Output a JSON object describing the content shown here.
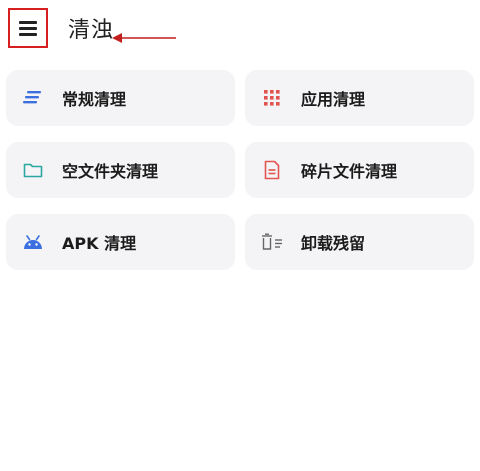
{
  "header": {
    "title": "清浊"
  },
  "colors": {
    "highlight_box": "#d61f1f",
    "arrow": "#c41f1f",
    "card_bg": "#f4f4f6",
    "blue": "#3b6fe0",
    "red": "#e2544f",
    "teal": "#2aa7a0",
    "gray": "#666666"
  },
  "cards": [
    {
      "label": "常规清理",
      "icon": "lines-icon"
    },
    {
      "label": "应用清理",
      "icon": "grid-dots-icon"
    },
    {
      "label": "空文件夹清理",
      "icon": "folder-icon"
    },
    {
      "label": "碎片文件清理",
      "icon": "document-icon"
    },
    {
      "label": "APK 清理",
      "icon": "android-icon"
    },
    {
      "label": "卸载残留",
      "icon": "trash-list-icon"
    }
  ]
}
